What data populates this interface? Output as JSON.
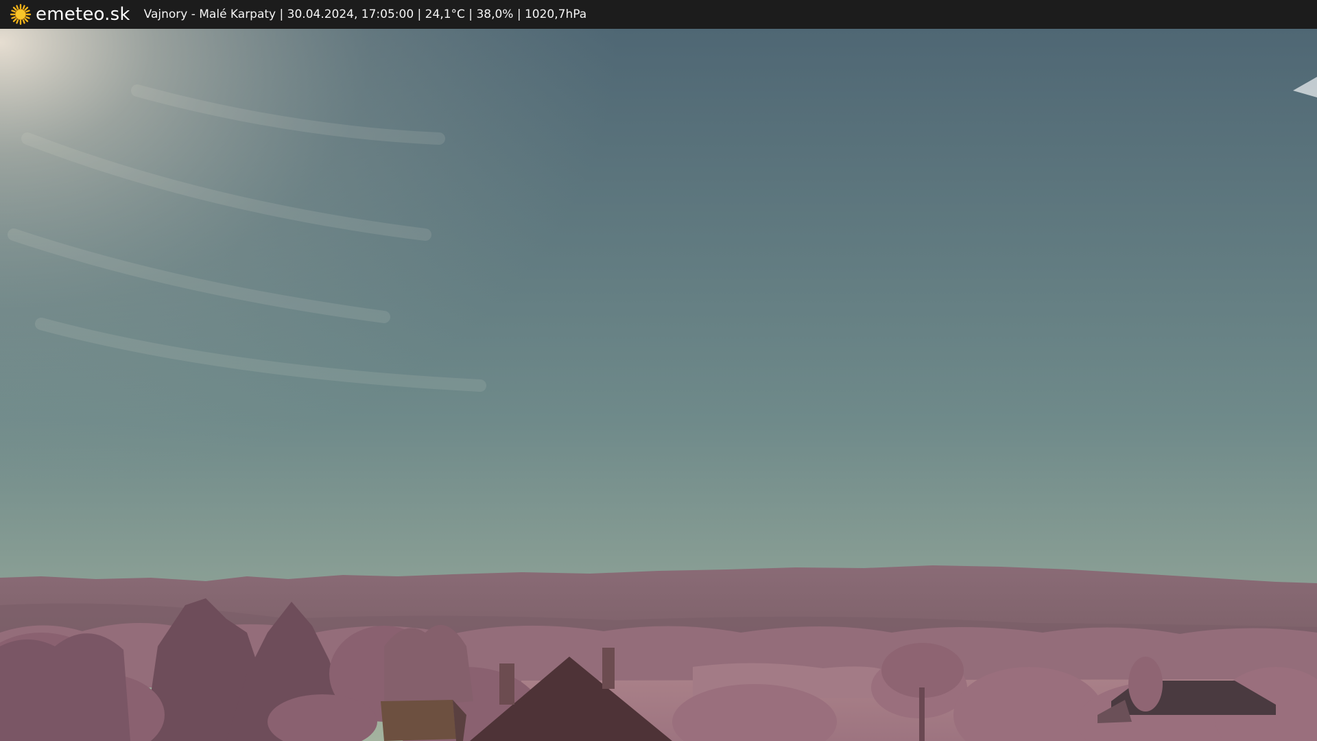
{
  "header": {
    "logo_text": "emeteo.sk",
    "logo_icon": "sun-icon",
    "caption": "Vajnory - Malé Karpaty | 30.04.2024, 17:05:00 | 24,1°C | 38,0% | 1020,7hPa"
  },
  "colors": {
    "bar_background": "#1c1c1c",
    "sun_yellow": "#f4b31a",
    "sky_top": "#4e6573",
    "sky_horizon": "#9cae9e",
    "hills": "#8a6a74",
    "foliage": "#9b6f7d"
  }
}
